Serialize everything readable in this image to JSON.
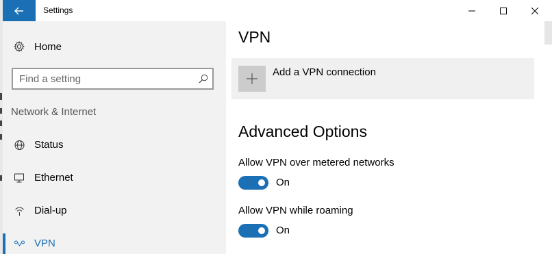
{
  "window": {
    "title": "Settings",
    "controls": [
      "minimize",
      "maximize",
      "close"
    ]
  },
  "sidebar": {
    "home_label": "Home",
    "search": {
      "placeholder": "Find a setting",
      "value": ""
    },
    "section_title": "Network & Internet",
    "items": [
      {
        "label": "Status",
        "icon": "globe-icon",
        "active": false
      },
      {
        "label": "Ethernet",
        "icon": "ethernet-icon",
        "active": false
      },
      {
        "label": "Dial-up",
        "icon": "dialup-icon",
        "active": false
      },
      {
        "label": "VPN",
        "icon": "vpn-icon",
        "active": true
      }
    ]
  },
  "main": {
    "title": "VPN",
    "add_vpn_label": "Add a VPN connection",
    "advanced_title": "Advanced Options",
    "options": [
      {
        "label": "Allow VPN over metered networks",
        "state": "On"
      },
      {
        "label": "Allow VPN while roaming",
        "state": "On"
      }
    ]
  },
  "colors": {
    "accent": "#1a6fb5",
    "sidebar_bg": "#f2f2f2",
    "tile_bg": "#f0f0f0"
  }
}
